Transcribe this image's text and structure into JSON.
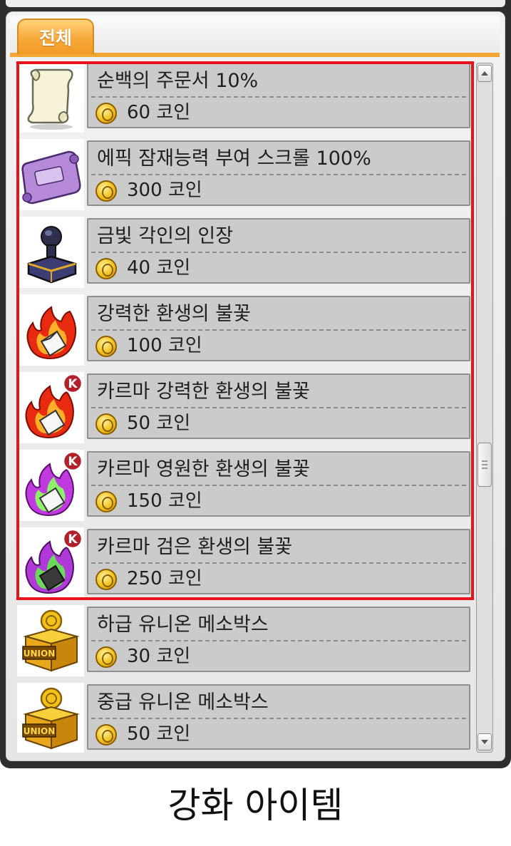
{
  "tab": {
    "label": "전체"
  },
  "items": [
    {
      "name": "순백의 주문서 10%",
      "price": "60 코인",
      "icon": "white-scroll-icon"
    },
    {
      "name": "에픽 잠재능력 부여 스크롤 100%",
      "price": "300 코인",
      "icon": "epic-potential-scroll-icon"
    },
    {
      "name": "금빛 각인의 인장",
      "price": "40 코인",
      "icon": "golden-seal-icon"
    },
    {
      "name": "강력한 환생의 불꽃",
      "price": "100 코인",
      "icon": "powerful-rebirth-flame-icon"
    },
    {
      "name": "카르마 강력한 환생의 불꽃",
      "price": "50 코인",
      "icon": "karma-powerful-rebirth-flame-icon"
    },
    {
      "name": "카르마 영원한 환생의 불꽃",
      "price": "150 코인",
      "icon": "karma-eternal-rebirth-flame-icon"
    },
    {
      "name": "카르마 검은 환생의 불꽃",
      "price": "250 코인",
      "icon": "karma-black-rebirth-flame-icon"
    },
    {
      "name": "하급 유니온 메소박스",
      "price": "30 코인",
      "icon": "union-meso-box-icon"
    },
    {
      "name": "중급 유니온 메소박스",
      "price": "50 코인",
      "icon": "union-meso-box-icon"
    }
  ],
  "icon_badges": {
    "karma_letter": "K",
    "union_text": "UNION"
  },
  "highlight_color": "#e8141c",
  "caption": "강화 아이템"
}
